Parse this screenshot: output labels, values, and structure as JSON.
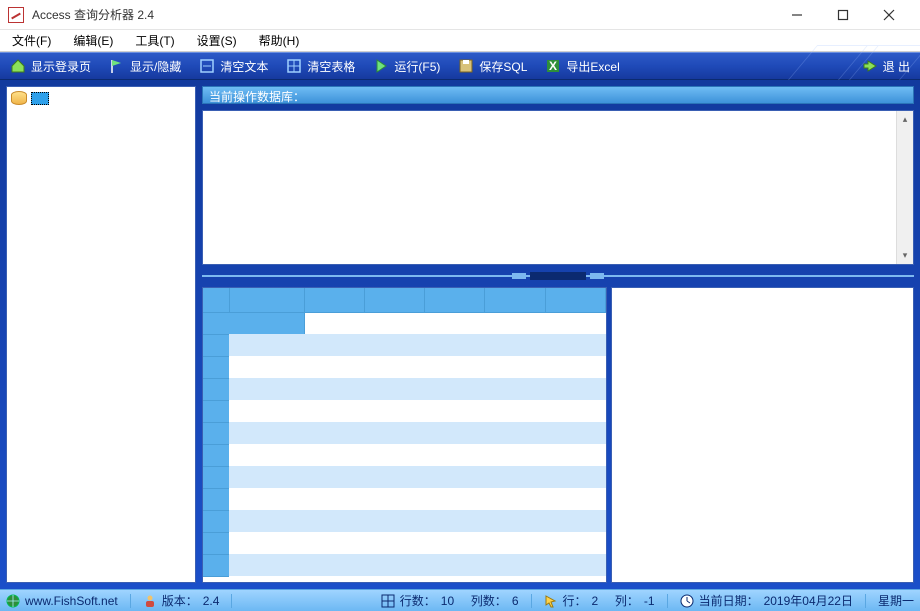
{
  "window": {
    "title": "Access 查询分析器 2.4"
  },
  "menu": {
    "file": "文件(F)",
    "edit": "编辑(E)",
    "tool": "工具(T)",
    "setting": "设置(S)",
    "help": "帮助(H)"
  },
  "toolbar": {
    "show_login": "显示登录页",
    "show_hide": "显示/隐藏",
    "clear_text": "清空文本",
    "clear_table": "清空表格",
    "run": "运行(F5)",
    "save_sql": "保存SQL",
    "export_excel": "导出Excel",
    "exit": "退 出"
  },
  "workspace": {
    "current_db_label": "当前操作数据库：",
    "current_db_value": ""
  },
  "grid": {
    "cols": 6,
    "rows": 12
  },
  "status": {
    "website": "www.FishSoft.net",
    "version_label": "版本：",
    "version_value": "2.4",
    "rows_label": "行数：",
    "rows_value": "10",
    "cols_label": "列数：",
    "cols_value": "6",
    "cursor_row_label": "行：",
    "cursor_row_value": "2",
    "cursor_col_label": "列：",
    "cursor_col_value": "-1",
    "date_label": "当前日期：",
    "date_value": "2019年04月22日",
    "weekday": "星期一"
  }
}
